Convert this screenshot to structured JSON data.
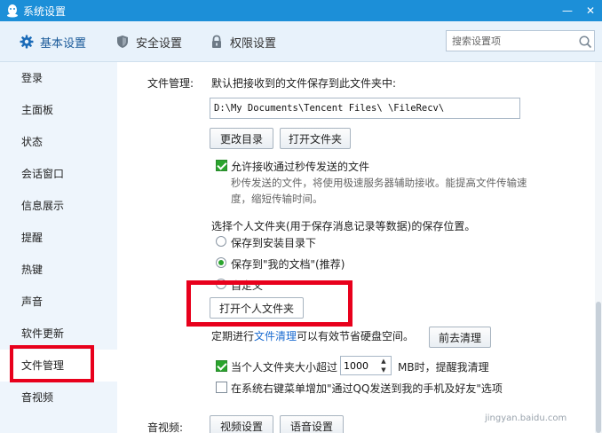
{
  "window": {
    "title": "系统设置",
    "minimize_glyph": "—",
    "close_glyph": "✕"
  },
  "tabs": [
    {
      "label": "基本设置",
      "icon": "gear-icon",
      "active": true
    },
    {
      "label": "安全设置",
      "icon": "shield-icon",
      "active": false
    },
    {
      "label": "权限设置",
      "icon": "lock-icon",
      "active": false
    }
  ],
  "search": {
    "placeholder": "搜索设置项",
    "icon": "search-icon"
  },
  "sidebar": {
    "items": [
      {
        "label": "登录"
      },
      {
        "label": "主面板"
      },
      {
        "label": "状态"
      },
      {
        "label": "会话窗口"
      },
      {
        "label": "信息展示"
      },
      {
        "label": "提醒"
      },
      {
        "label": "热键"
      },
      {
        "label": "声音"
      },
      {
        "label": "软件更新"
      },
      {
        "label": "文件管理",
        "active": true
      },
      {
        "label": "音视频"
      }
    ]
  },
  "file_management": {
    "section_label": "文件管理:",
    "save_desc": "默认把接收到的文件保存到此文件夹中:",
    "path": "D:\\My Documents\\Tencent Files\\         \\FileRecv\\",
    "change_dir_button": "更改目录",
    "open_folder_button": "打开文件夹",
    "allow_instant": {
      "checked": true,
      "label": "允许接收通过秒传发送的文件",
      "desc_line1": "秒传发送的文件，将使用极速服务器辅助接收。能提高文件传输速",
      "desc_line2": "度，缩短传输时间。"
    },
    "personal_folder_desc": "选择个人文件夹(用于保存消息记录等数据)的保存位置。",
    "radio_options": [
      {
        "label": "保存到安装目录下",
        "selected": false
      },
      {
        "label": "保存到\"我的文档\"(推荐)",
        "selected": true
      },
      {
        "label": "自定义",
        "selected": false
      }
    ],
    "open_personal_button": "打开个人文件夹",
    "cleanup": {
      "prefix": "定期进行",
      "link": "文件清理",
      "suffix": "可以有效节省硬盘空间。",
      "button": "前去清理"
    },
    "size_alert": {
      "checked": true,
      "prefix": "当个人文件夹大小超过",
      "value": "1000",
      "suffix": "MB时，提醒我清理"
    },
    "context_menu": {
      "checked": false,
      "label": "在系统右键菜单增加\"通过QQ发送到我的手机及好友\"选项"
    }
  },
  "audio_video": {
    "section_label": "音视频:",
    "video_button": "视频设置",
    "voice_button": "语音设置"
  },
  "watermark": "jingyan.baidu.com",
  "colors": {
    "titlebar": "#1c8fd8",
    "highlight": "#e8001c",
    "check_green": "#2aa42d",
    "link": "#1a6bd0"
  }
}
